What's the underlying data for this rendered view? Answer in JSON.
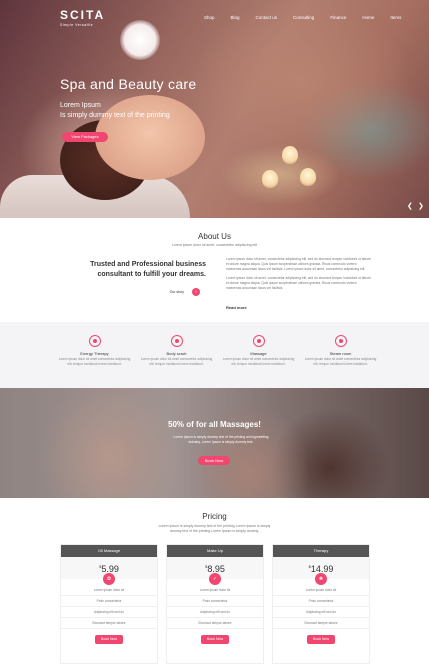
{
  "brand": {
    "name": "SCITA",
    "tagline": "Simple Versatile"
  },
  "nav": [
    "Shop",
    "Blog",
    "Contact us",
    "Consulting",
    "Finance",
    "Home",
    "Items"
  ],
  "hero": {
    "title": "Spa and Beauty care",
    "subtitle_line1": "Lorem Ipsum",
    "subtitle_line2": "Is simply dummy text of the printing",
    "button": "View Packages",
    "prev_icon": "chevron-left-icon",
    "next_icon": "chevron-right-icon"
  },
  "about": {
    "title": "About Us",
    "subtitle": "Lorem ipsum dolor sit amet, consectetur adipisicing elit",
    "heading_line1": "Trusted and Professional business",
    "heading_line2": "consultant to fulfill your dreams.",
    "story_label": "Our story",
    "para1": "Lorem ipsum dolor sit amet, consectetur adipisicing elit, sed do eiusmod tempor incididunt ut labore et dolore magna aliqua. Quis ipsum suspendisse ultrices gravida. Risus commodo viverra maecenas accumsan lacus vel facilisis. Lorem ipsum dolor sit amet, consectetur adipisicing elit.",
    "para2": "Lorem ipsum dolor sit amet, consectetur adipisicing elit, sed do eiusmod tempor incididunt ut labore et dolore magna aliqua. Quis ipsum suspendisse ultrices gravida. Risus commodo viverra maecenas accumsan lacus vel facilisis.",
    "read_more": "Read more"
  },
  "services": [
    {
      "name": "Energy Therapy",
      "desc": "Lorem ipsum dolor sit amet consectetur adipisicing elit, tempor incididunt lorem incididunt."
    },
    {
      "name": "Body scrub",
      "desc": "Lorem ipsum dolor sit amet consectetur adipisicing elit, tempor incididunt lorem incididunt."
    },
    {
      "name": "Massage",
      "desc": "Lorem ipsum dolor sit amet consectetur adipisicing elit, tempor incididunt lorem incididunt."
    },
    {
      "name": "Steam room",
      "desc": "Lorem ipsum dolor sit amet consectetur adipisicing elit, tempor incididunt lorem incididunt."
    }
  ],
  "promo": {
    "title": "50% of for all Massages!",
    "subtitle": "Lorem Ipsum is simply dummy text of the printing and typesetting industry. Lorem Ipsum is simply dummy text.",
    "button": "Book Now"
  },
  "pricing": {
    "title": "Pricing",
    "subtitle": "Lorem Ipsum is simply dummy text of the printing Lorem Ipsum is simply dummy text of the printing Lorem ipsum is simply dummy.",
    "plans": [
      {
        "name": "Oil Massage",
        "currency": "$",
        "price": "5.99",
        "features": [
          "Lorem ipsum dolor sit",
          "Proin consectetur",
          "Adipiscing elit sed do",
          "Eiusmod tempor labore"
        ],
        "button": "Book Now"
      },
      {
        "name": "Make Up",
        "currency": "$",
        "price": "8.95",
        "features": [
          "Lorem ipsum dolor sit",
          "Proin consectetur",
          "Adipiscing elit sed do",
          "Eiusmod tempor labore"
        ],
        "button": "Book Now"
      },
      {
        "name": "Therapy",
        "currency": "$",
        "price": "14.99",
        "features": [
          "Lorem ipsum dolor sit",
          "Proin consectetur",
          "Adipiscing elit sed do",
          "Eiusmod tempor labore"
        ],
        "button": "Book Now"
      }
    ]
  },
  "colors": {
    "accent": "#f0466f",
    "plan_header": "#555555",
    "services_bg": "#f4f4f6"
  }
}
